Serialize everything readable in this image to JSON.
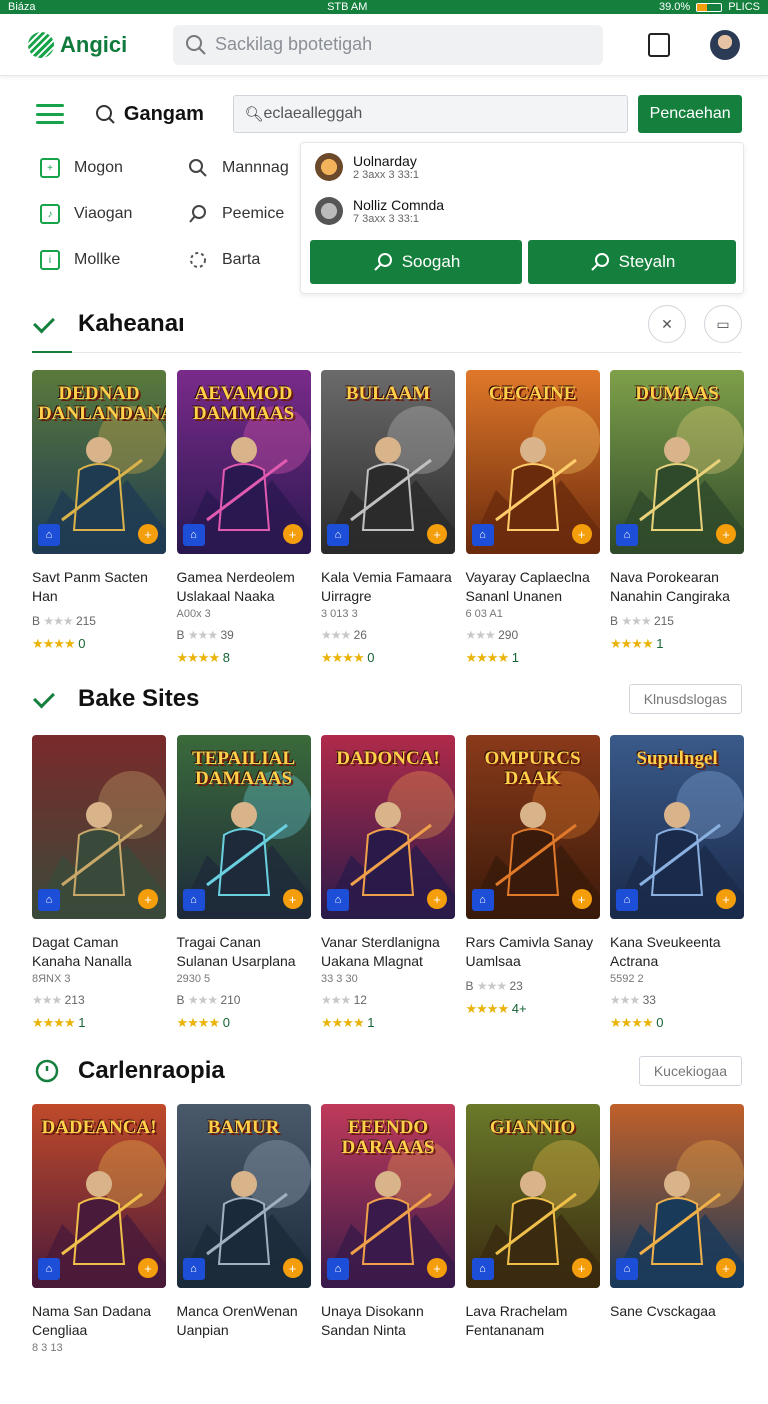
{
  "status": {
    "left": "Biáza",
    "time": "STB AM",
    "battery": "39.0%",
    "right": "PLICS",
    "battery_level": 0.39
  },
  "app": {
    "name": "Angici",
    "search_placeholder": "Sackilag bpotetigah"
  },
  "nav": {
    "brand": "Gangam",
    "search_value": "eclaealleggah",
    "button_label": "Pencaehan"
  },
  "menu": [
    {
      "label": "Mogon",
      "icon": "square-plus-icon"
    },
    {
      "label": "Mannnag",
      "icon": "search-icon"
    },
    {
      "label": "Viaogan",
      "icon": "square-note-icon"
    },
    {
      "label": "Peemice",
      "icon": "search-icon"
    },
    {
      "label": "Mollke",
      "icon": "square-info-icon"
    },
    {
      "label": "Barta",
      "icon": "spinner-icon"
    }
  ],
  "dropdown": {
    "items": [
      {
        "title": "Uolnarday",
        "sub": "2 3axx 3 33:1"
      },
      {
        "title": "Nolliz Comnda",
        "sub": "7 3axx 3 33:1"
      }
    ],
    "btn1": "Soogah",
    "btn2": "Steyaln"
  },
  "sections": [
    {
      "title": "Kaheanaı",
      "action": "",
      "cards": [
        {
          "art_title": "DEDNAD DANLANDANAM",
          "name": "Savt Panm Sacten Han",
          "sub": "",
          "rate": "B ★★★ 215",
          "rate2": "★★★★ 0",
          "theme": "a"
        },
        {
          "art_title": "AEVAMOD DAMMAAS",
          "name": "Gamea Nerdeolem Uslakaal Naaka",
          "sub": "A00x 3",
          "rate": "B ★★★ 39",
          "rate2": "★★★★ 8",
          "theme": "b"
        },
        {
          "art_title": "BULAAM",
          "name": "Kala Vemia Famaara Uirragre",
          "sub": "3 013 3",
          "rate": "★★★ 26",
          "rate2": "★★★★ 0",
          "theme": "c"
        },
        {
          "art_title": "CECAINE",
          "name": "Vayaray Caplaeclna Sananl Unanen",
          "sub": "6 03 A1",
          "rate": "★★★ 290",
          "rate2": "★★★★ 1",
          "theme": "d"
        },
        {
          "art_title": "DUMAAS",
          "name": "Nava Porokearan Nanahin Cangiraka",
          "sub": "",
          "rate": "B ★★★ 215",
          "rate2": "★★★★ 1",
          "theme": "e"
        }
      ]
    },
    {
      "title": "Bake Sites",
      "action": "Klnusdslogas",
      "cards": [
        {
          "art_title": "",
          "name": "Dagat Caman Kanaha Nanalla",
          "sub": "8ЯNX 3",
          "rate": "★★★ 213",
          "rate2": "★★★★ 1",
          "theme": "f"
        },
        {
          "art_title": "TEPAILIAL DAMAAAS",
          "name": "Tragai Canan Sulanan Usarplana",
          "sub": "2930 5",
          "rate": "B ★★★ 210",
          "rate2": "★★★★ 0",
          "theme": "g"
        },
        {
          "art_title": "DADONCA!",
          "name": "Vanar Sterdlanigna Uakana Mlagnat",
          "sub": "33 3 30",
          "rate": "★★★ 12",
          "rate2": "★★★★ 1",
          "theme": "h"
        },
        {
          "art_title": "OMPURCS DAAK",
          "name": "Rars Camivla Sanay Uamlsaa",
          "sub": "",
          "rate": "B ★★★ 23",
          "rate2": "★★★★ 4+",
          "theme": "i"
        },
        {
          "art_title": "Supulngel",
          "name": "Kana Sveukeenta Actrana",
          "sub": "5592 2",
          "rate": "★★★ 33",
          "rate2": "★★★★ 0",
          "theme": "j"
        }
      ]
    },
    {
      "title": "Carlenraopia",
      "action": "Kucekiogaa",
      "cards": [
        {
          "art_title": "DADEANCA!",
          "name": "Nama San Dadana Cengliaa",
          "sub": "8 3 13",
          "rate": "",
          "rate2": "",
          "theme": "k"
        },
        {
          "art_title": "BAMUR",
          "name": "Manca OrenWenan Uanpian",
          "sub": "",
          "rate": "",
          "rate2": "",
          "theme": "l"
        },
        {
          "art_title": "EEENDO DARAAAS",
          "name": "Unaya Disokann Sandan Ninta",
          "sub": "",
          "rate": "",
          "rate2": "",
          "theme": "m"
        },
        {
          "art_title": "GIANNIO",
          "name": "Lava Rrachelam Fentananam",
          "sub": "",
          "rate": "",
          "rate2": "",
          "theme": "n"
        },
        {
          "art_title": "",
          "name": "Sane Cvsckagaa",
          "sub": "",
          "rate": "",
          "rate2": "",
          "theme": "o"
        }
      ]
    }
  ]
}
